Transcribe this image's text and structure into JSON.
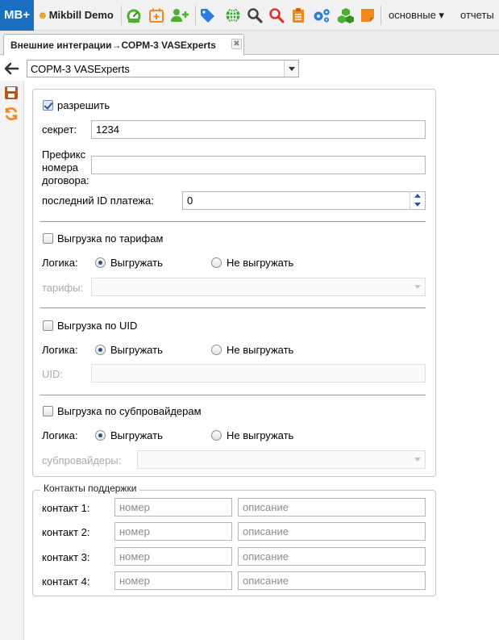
{
  "toolbar": {
    "logo": "MB+",
    "brand": "Mikbill Demo",
    "menu_main": "основные ▾",
    "menu_reports": "отчеты",
    "colors": {
      "logo_bg": "#1b6fc2",
      "green": "#4caf2f",
      "orange": "#f0891d",
      "blue": "#2a7de1",
      "red": "#e0322c"
    },
    "icons": [
      "dashboard-icon",
      "calendar-plus-icon",
      "add-user-icon",
      "tag-icon",
      "globe-icon",
      "search-icon",
      "search-red-icon",
      "clipboard-icon",
      "gears-icon",
      "cubes-icon",
      "sticky-note-icon"
    ]
  },
  "tab": {
    "label": "Внешние интеграции→СОРМ-3 VASExperts",
    "close": "✖"
  },
  "selector": {
    "value": "СОРМ-3 VASExperts"
  },
  "form": {
    "allow_label": "разрешить",
    "allow_checked": true,
    "secret_label": "секрет:",
    "secret_value": "1234",
    "prefix_label_1": "Префикс",
    "prefix_label_2": "номера",
    "prefix_label_3": "договора:",
    "prefix_value": "",
    "last_payment_label": "последний ID платежа:",
    "last_payment_value": "0",
    "tariffs": {
      "checkbox_label": "Выгрузка по тарифам",
      "logic_label": "Логика:",
      "opt_export": "Выгружать",
      "opt_no_export": "Не выгружать",
      "field_label": "тарифы:"
    },
    "uid": {
      "checkbox_label": "Выгрузка по UID",
      "logic_label": "Логика:",
      "opt_export": "Выгружать",
      "opt_no_export": "Не выгружать",
      "field_label": "UID:"
    },
    "subproviders": {
      "checkbox_label": "Выгрузка по субпровайдерам",
      "logic_label": "Логика:",
      "opt_export": "Выгружать",
      "opt_no_export": "Не выгружать",
      "field_label": "субпровайдеры:"
    }
  },
  "contacts": {
    "legend": "Контакты поддержки",
    "number_placeholder": "номер",
    "description_placeholder": "описание",
    "rows": [
      {
        "label": "контакт 1:"
      },
      {
        "label": "контакт 2:"
      },
      {
        "label": "контакт 3:"
      },
      {
        "label": "контакт 4:"
      }
    ]
  }
}
